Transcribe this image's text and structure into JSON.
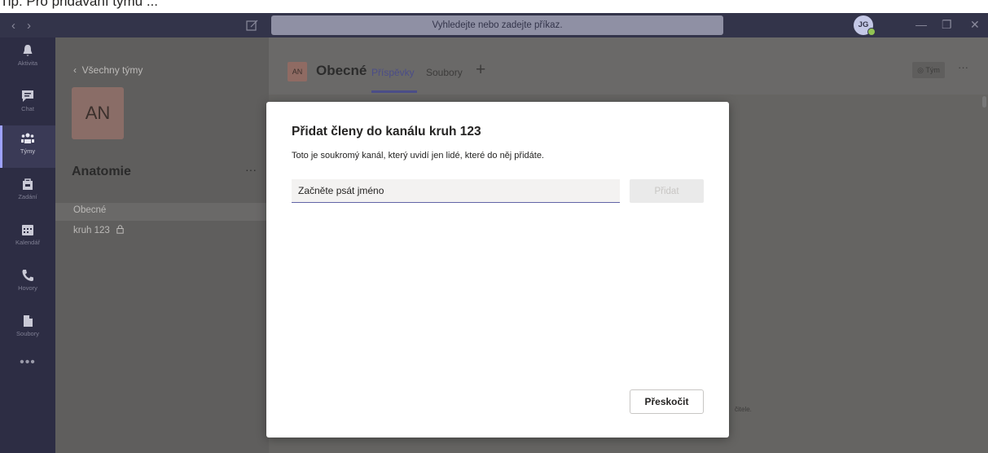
{
  "caption": "Tip: Pro přidávání týmu ...",
  "titlebar": {
    "search_placeholder": "Vyhledejte nebo zadejte příkaz.",
    "user_initials": "JG"
  },
  "rail": {
    "items": [
      {
        "label": "Aktivita",
        "icon": "bell-icon"
      },
      {
        "label": "Chat",
        "icon": "chat-icon"
      },
      {
        "label": "Týmy",
        "icon": "teams-icon"
      },
      {
        "label": "Zadání",
        "icon": "assignments-icon"
      },
      {
        "label": "Kalendář",
        "icon": "calendar-icon"
      },
      {
        "label": "Hovory",
        "icon": "phone-icon"
      },
      {
        "label": "Soubory",
        "icon": "files-icon"
      }
    ],
    "more": "•••"
  },
  "team": {
    "back_label": "Všechny týmy",
    "avatar_initials": "AN",
    "name": "Anatomie",
    "more": "···",
    "channels": [
      {
        "label": "Obecné"
      },
      {
        "label": "kruh 123"
      }
    ]
  },
  "channel_header": {
    "avatar_initials": "AN",
    "title": "Obecné",
    "tabs": [
      {
        "label": "Příspěvky"
      },
      {
        "label": "Soubory"
      }
    ],
    "add_tab": "+",
    "team_button": "Tým",
    "more": "···"
  },
  "background_text": "čitele.",
  "dialog": {
    "title": "Přidat členy do kanálu kruh 123",
    "subtitle": "Toto je soukromý kanál, který uvidí jen lidé, které do něj přidáte.",
    "input_placeholder": "Začněte psát jméno",
    "input_value": "",
    "add_button": "Přidat",
    "skip_button": "Přeskočit"
  },
  "colors": {
    "accent": "#6264a7",
    "titlebar": "#33344a",
    "rail": "#2d2d44"
  }
}
